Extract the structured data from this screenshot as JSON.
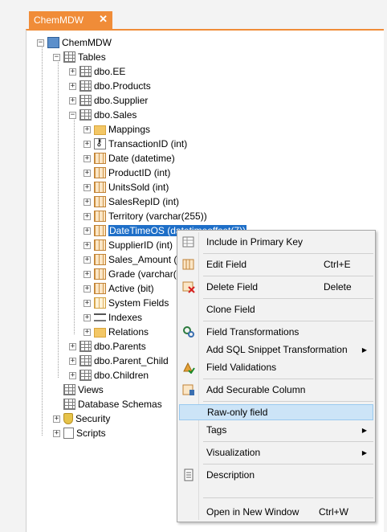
{
  "tab": {
    "title": "ChemMDW",
    "close": "✕"
  },
  "tree": {
    "root": "ChemMDW",
    "tables": "Tables",
    "ee": "dbo.EE",
    "products": "dbo.Products",
    "supplier": "dbo.Supplier",
    "sales": "dbo.Sales",
    "mappings": "Mappings",
    "f_transaction": "TransactionID (int)",
    "f_date": "Date (datetime)",
    "f_product": "ProductID (int)",
    "f_units": "UnitsSold (int)",
    "f_salesrep": "SalesRepID (int)",
    "f_territory": "Territory (varchar(255))",
    "f_datetimeos": "DateTimeOS (datetimeoffset(7))",
    "f_supplier": "SupplierID (int)",
    "f_salesamount": "Sales_Amount (d",
    "f_grade": "Grade (varchar(2",
    "f_active": "Active (bit)",
    "system_fields": "System Fields",
    "indexes": "Indexes",
    "relations": "Relations",
    "parents": "dbo.Parents",
    "parent_child": "dbo.Parent_Child",
    "children": "dbo.Children",
    "views": "Views",
    "db_schemas": "Database Schemas",
    "security": "Security",
    "scripts": "Scripts"
  },
  "menu": {
    "include_pk": "Include in Primary Key",
    "edit_field": "Edit Field",
    "edit_field_sc": "Ctrl+E",
    "delete_field": "Delete Field",
    "delete_field_sc": "Delete",
    "clone_field": "Clone Field",
    "field_transformations": "Field Transformations",
    "add_sql_snippet": "Add SQL Snippet Transformation",
    "field_validations": "Field Validations",
    "add_securable": "Add Securable Column",
    "raw_only": "Raw-only field",
    "tags": "Tags",
    "visualization": "Visualization",
    "description": "Description",
    "open_new_window": "Open in New Window",
    "open_new_window_sc": "Ctrl+W"
  },
  "colors": {
    "accent": "#f08c38",
    "selection": "#1e6fc8",
    "menu_highlight": "#cce4f7"
  }
}
